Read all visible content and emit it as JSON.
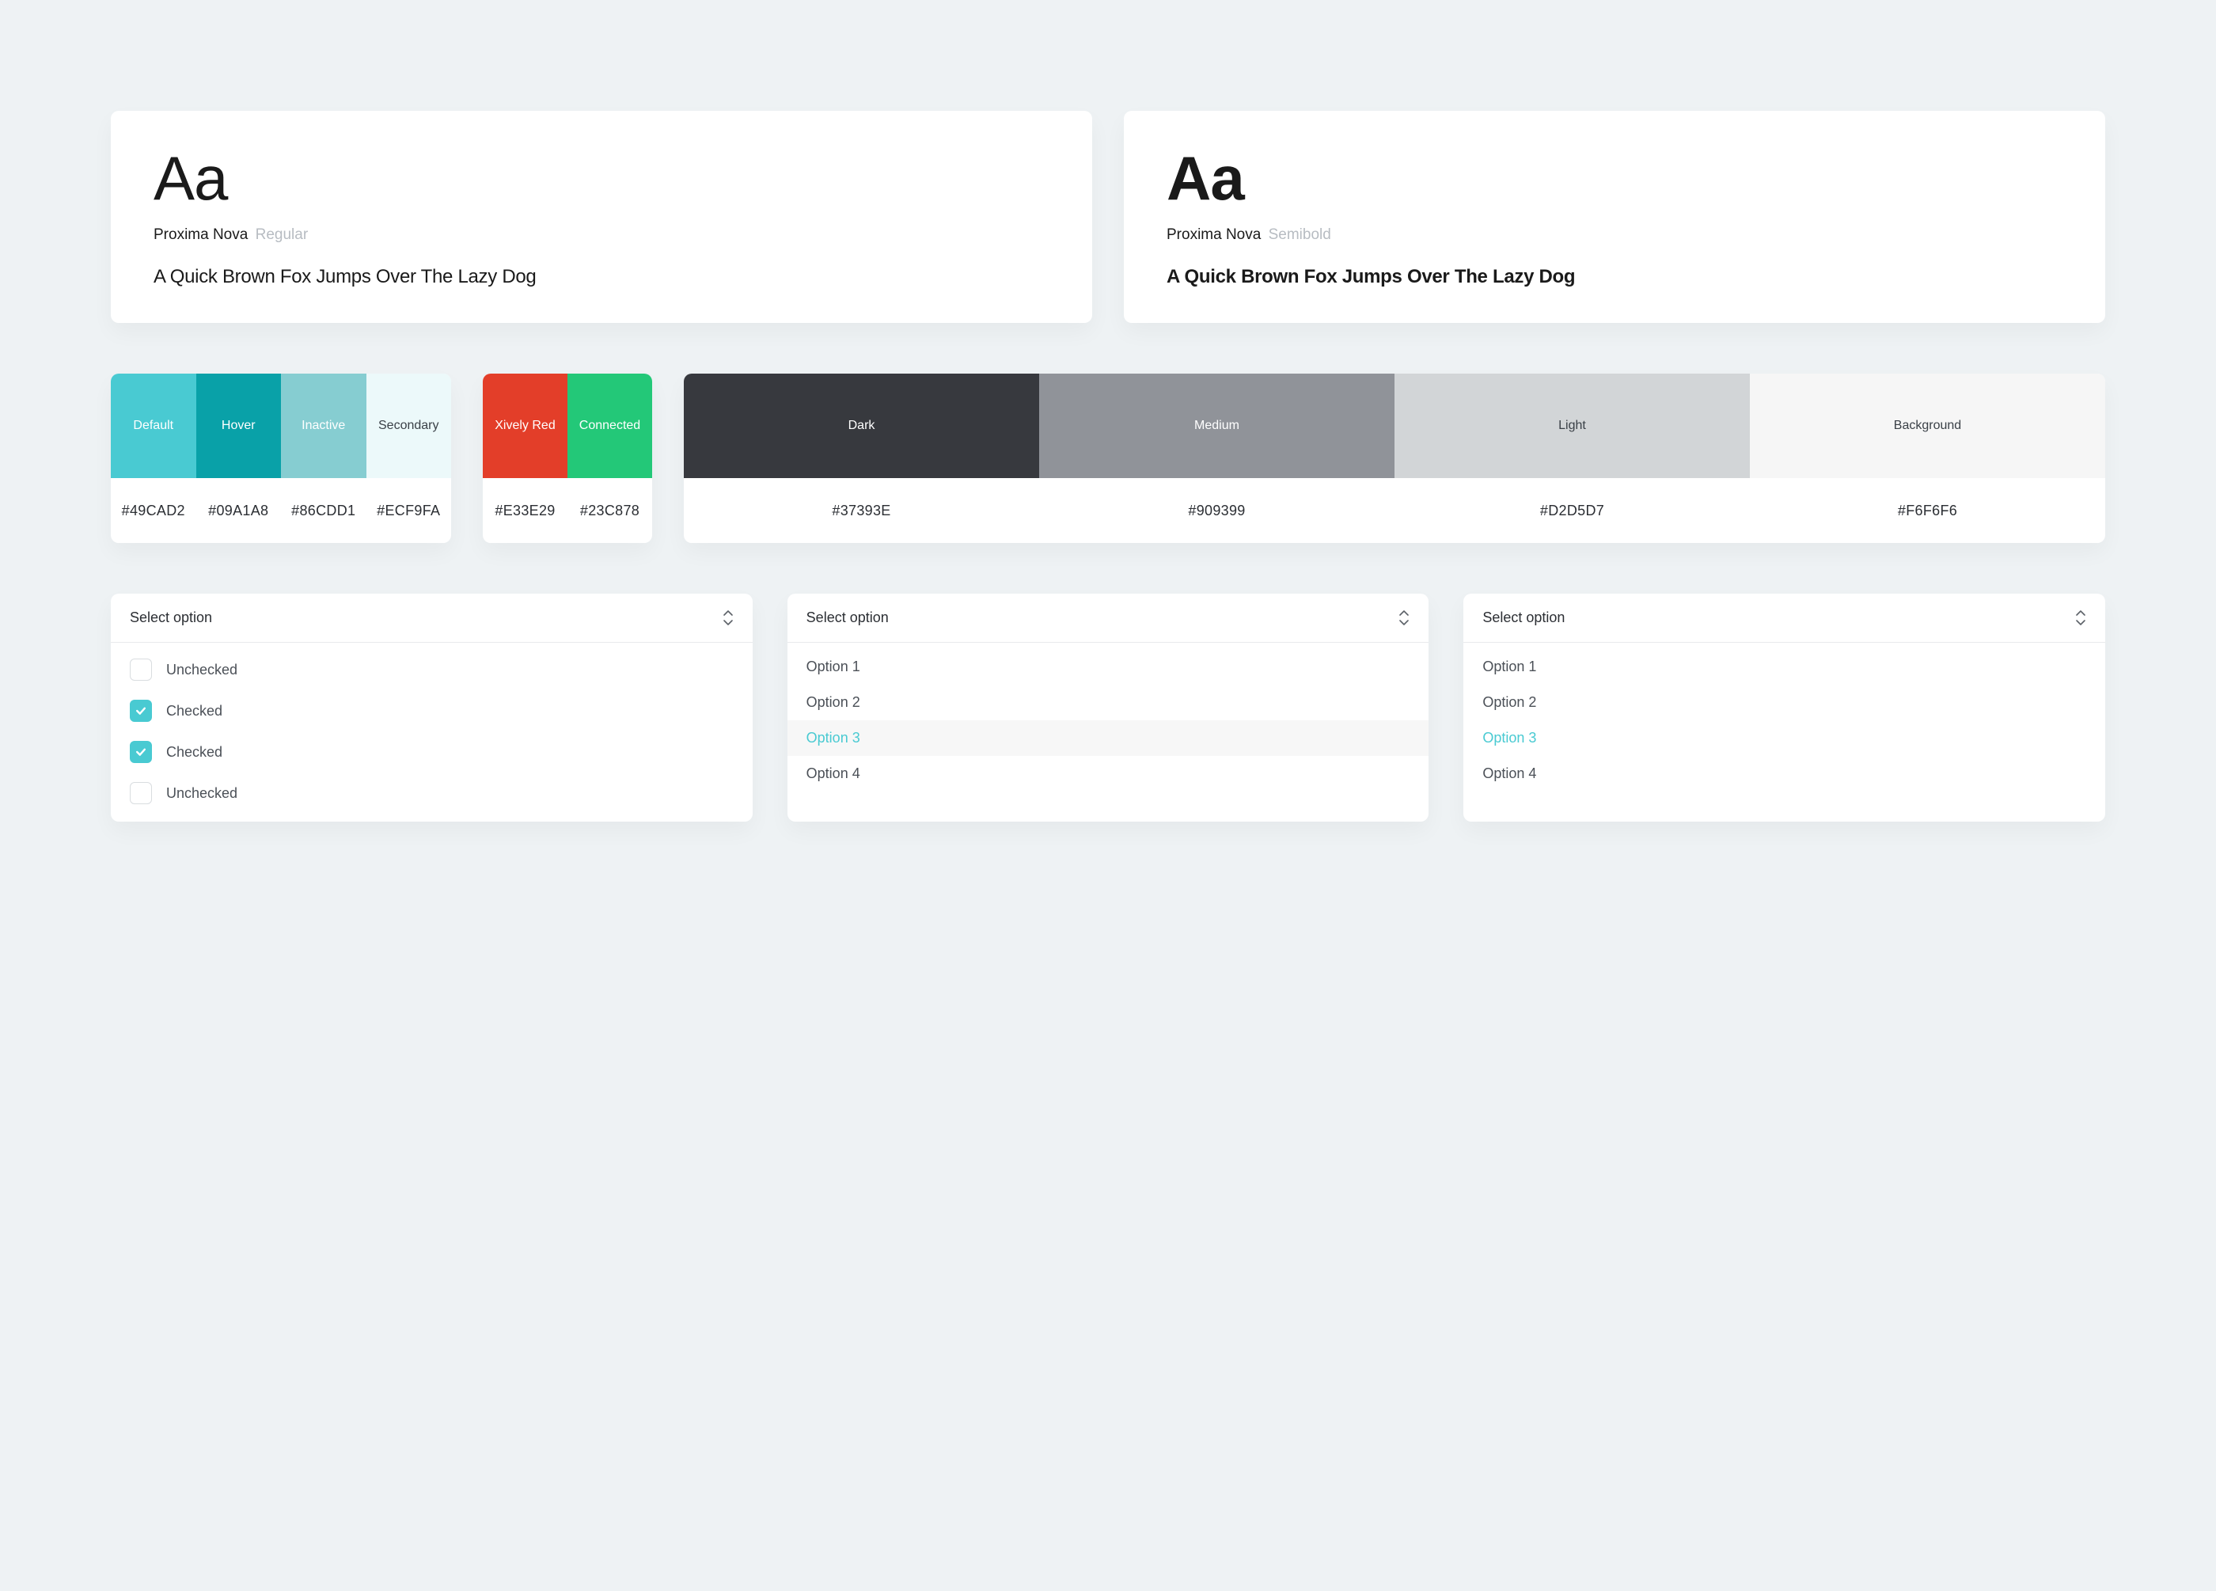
{
  "typography": [
    {
      "sample": "Aa",
      "family": "Proxima Nova",
      "weight": "Regular",
      "semibold": false,
      "pangram": "A Quick Brown Fox Jumps Over The Lazy Dog"
    },
    {
      "sample": "Aa",
      "family": "Proxima Nova",
      "weight": "Semibold",
      "semibold": true,
      "pangram": "A Quick Brown Fox Jumps Over The Lazy Dog"
    }
  ],
  "palettes": [
    {
      "id": "primary",
      "swatches": [
        {
          "label": "Default",
          "hex": "#49CAD2",
          "dark_text": false
        },
        {
          "label": "Hover",
          "hex": "#09A1A8",
          "dark_text": false
        },
        {
          "label": "Inactive",
          "hex": "#86CDD1",
          "dark_text": false
        },
        {
          "label": "Secondary",
          "hex": "#ECF9FA",
          "dark_text": true
        }
      ]
    },
    {
      "id": "status",
      "swatches": [
        {
          "label": "Xively Red",
          "hex": "#E33E29",
          "dark_text": false
        },
        {
          "label": "Connected",
          "hex": "#23C878",
          "dark_text": false
        }
      ]
    },
    {
      "id": "neutral",
      "swatches": [
        {
          "label": "Dark",
          "hex": "#37393E",
          "dark_text": false
        },
        {
          "label": "Medium",
          "hex": "#909399",
          "dark_text": false
        },
        {
          "label": "Light",
          "hex": "#D2D5D7",
          "dark_text": true
        },
        {
          "label": "Background",
          "hex": "#F6F6F6",
          "dark_text": true
        }
      ]
    }
  ],
  "dropdowns": {
    "header_label": "Select option",
    "checkbox_list": [
      {
        "label": "Unchecked",
        "checked": false
      },
      {
        "label": "Checked",
        "checked": true
      },
      {
        "label": "Checked",
        "checked": true
      },
      {
        "label": "Unchecked",
        "checked": false
      }
    ],
    "hover_list": [
      {
        "label": "Option 1"
      },
      {
        "label": "Option 2"
      },
      {
        "label": "Option 3",
        "highlight": true
      },
      {
        "label": "Option 4"
      }
    ],
    "selected_list": [
      {
        "label": "Option 1"
      },
      {
        "label": "Option 2"
      },
      {
        "label": "Option 3",
        "selected": true
      },
      {
        "label": "Option 4"
      }
    ]
  }
}
